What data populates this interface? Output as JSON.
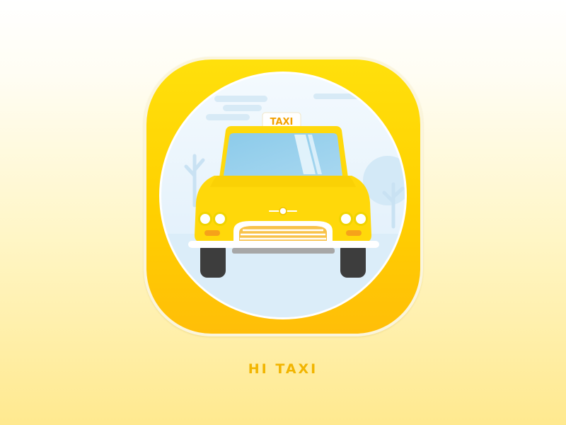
{
  "app": {
    "name": "HI TAXI",
    "icon_name": "taxi-car-icon",
    "roof_sign_text": "TAXI"
  },
  "colors": {
    "tile_top": "#ffe00c",
    "tile_bottom": "#ffbe08",
    "car_body": "#ffd80a",
    "sky": "#e3f2fb",
    "label": "#f2b500"
  }
}
